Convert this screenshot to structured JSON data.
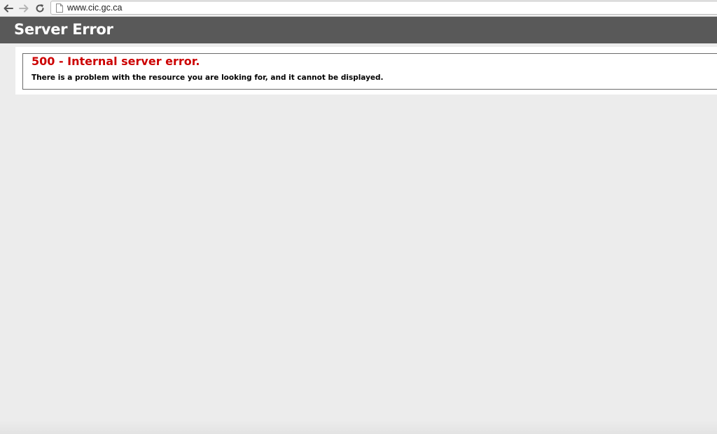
{
  "browser": {
    "url": "www.cic.gc.ca",
    "icons": {
      "back": "back-arrow-icon",
      "forward": "forward-arrow-icon",
      "reload": "reload-icon",
      "page": "page-document-icon"
    }
  },
  "header": {
    "title": "Server Error"
  },
  "error": {
    "heading": "500 - Internal server error.",
    "message": "There is a problem with the resource you are looking for, and it cannot be displayed."
  },
  "colors": {
    "header_bg": "#575757",
    "error_heading": "#cc0000",
    "page_bg": "#ececec"
  }
}
